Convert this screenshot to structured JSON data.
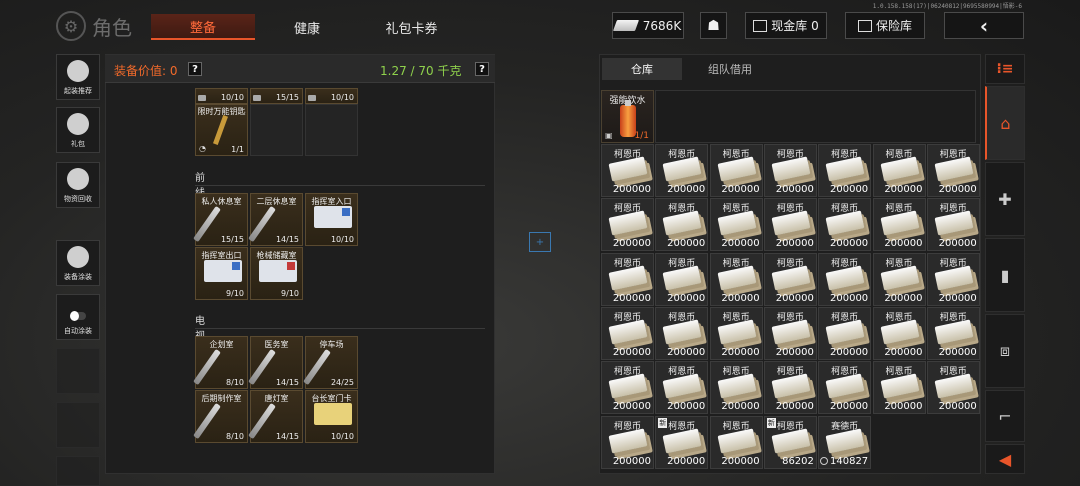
{
  "version": "1.0.158.158(17)|06240812|9695580994|悟影-6",
  "header": {
    "title": "角色",
    "tabs": [
      {
        "label": "整备"
      },
      {
        "label": "健康"
      },
      {
        "label": "礼包卡券"
      }
    ],
    "money": "7686K",
    "cash_vault": "现金库 0",
    "safe": "保险库",
    "back_icon": "‹"
  },
  "sidebar": {
    "items": [
      {
        "label": "起装推荐",
        "icon": "rifle-icon"
      },
      {
        "label": "礼包",
        "icon": "gift-icon"
      },
      {
        "label": "物资回收",
        "icon": "recycle-icon"
      },
      {
        "label": "装备涂装",
        "icon": "paint-icon"
      },
      {
        "label": "自动涂装",
        "icon": "toggle-icon"
      }
    ]
  },
  "left_panel": {
    "value_label": "装备价值: 0",
    "weight": "1.27 / 70 千克",
    "help": "?",
    "top_items": [
      {
        "name": "",
        "count": "10/10"
      },
      {
        "name": "",
        "count": "15/15"
      },
      {
        "name": "",
        "count": "10/10"
      },
      {
        "name": "限时万能钥匙",
        "count": "1/1"
      }
    ],
    "sections": [
      {
        "title": "前线要塞",
        "items": [
          {
            "name": "私人休息室",
            "count": "15/15",
            "kind": "key"
          },
          {
            "name": "二层休息室",
            "count": "14/15",
            "kind": "key"
          },
          {
            "name": "指挥室入口",
            "count": "10/10",
            "kind": "card"
          },
          {
            "name": "指挥室出口",
            "count": "9/10",
            "kind": "card"
          },
          {
            "name": "枪械储藏室",
            "count": "9/10",
            "kind": "card-red"
          }
        ]
      },
      {
        "title": "电视台",
        "items": [
          {
            "name": "企划室",
            "count": "8/10",
            "kind": "key"
          },
          {
            "name": "医务室",
            "count": "14/15",
            "kind": "key"
          },
          {
            "name": "停车场",
            "count": "24/25",
            "kind": "key"
          },
          {
            "name": "后期制作室",
            "count": "8/10",
            "kind": "key"
          },
          {
            "name": "唐灯室",
            "count": "14/15",
            "kind": "key"
          },
          {
            "name": "台长室门卡",
            "count": "10/10",
            "kind": "card-gold"
          }
        ]
      }
    ]
  },
  "center_marker": "+",
  "right_panel": {
    "tabs": [
      {
        "label": "仓库"
      },
      {
        "label": "组队借用"
      }
    ],
    "special_item": {
      "name": "强能饮水",
      "count": "1/1"
    },
    "currency_name": "柯恩币",
    "full_count": "200000",
    "last_items": [
      {
        "name": "柯恩币",
        "count": "86202",
        "new": "新"
      },
      {
        "name": "赛德币",
        "count": "140827",
        "new": ""
      }
    ],
    "new_badge": "新"
  },
  "rail": {
    "top": "⁝≡",
    "items": [
      "home-icon",
      "medkit-icon",
      "ammo-icon",
      "box-icon",
      "gun-icon",
      "collapse-icon"
    ]
  }
}
